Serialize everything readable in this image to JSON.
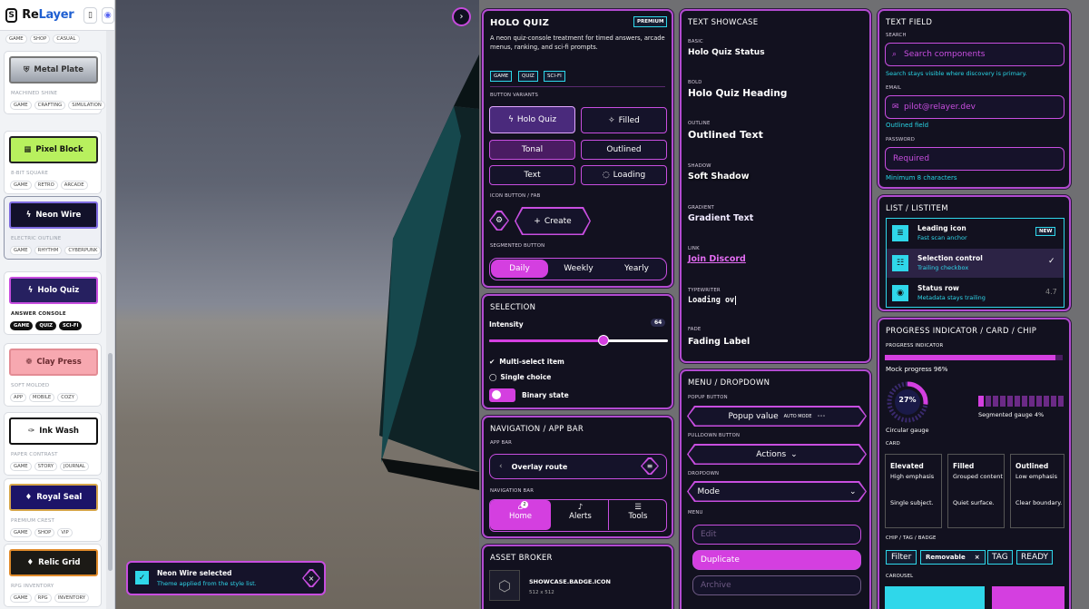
{
  "app": {
    "brand_a": "Re",
    "brand_b": "Layer",
    "book_icon": "book-icon",
    "discord_icon": "discord-icon"
  },
  "sidebar": {
    "top_tags": [
      "GAME",
      "SHOP",
      "CASUAL"
    ],
    "items": [
      {
        "label": "Metal Plate",
        "caption": "MACHINED SHINE",
        "tags": [
          "GAME",
          "CRAFTING",
          "SIMULATION"
        ]
      },
      {
        "label": "Pixel Block",
        "caption": "8-BIT SQUARE",
        "tags": [
          "GAME",
          "RETRO",
          "ARCADE"
        ]
      },
      {
        "label": "Neon Wire",
        "caption": "ELECTRIC OUTLINE",
        "tags": [
          "GAME",
          "RHYTHM",
          "CYBERPUNK"
        ]
      },
      {
        "label": "Holo Quiz",
        "caption": "ANSWER CONSOLE",
        "tags": [
          "GAME",
          "QUIZ",
          "SCI-FI"
        ]
      },
      {
        "label": "Clay Press",
        "caption": "SOFT MOLDED",
        "tags": [
          "APP",
          "MOBILE",
          "COZY"
        ]
      },
      {
        "label": "Ink Wash",
        "caption": "PAPER CONTRAST",
        "tags": [
          "GAME",
          "STORY",
          "JOURNAL"
        ]
      },
      {
        "label": "Royal Seal",
        "caption": "PREMIUM CREST",
        "tags": [
          "GAME",
          "SHOP",
          "VIP"
        ]
      },
      {
        "label": "Relic Grid",
        "caption": "RPG INVENTORY",
        "tags": [
          "GAME",
          "RPG",
          "INVENTORY"
        ]
      }
    ]
  },
  "toast": {
    "title": "Neon Wire selected",
    "message": "Theme applied from the style list."
  },
  "holo": {
    "title": "HOLO QUIZ",
    "badge": "PREMIUM",
    "desc": "A neon quiz-console treatment for timed answers, arcade menus, ranking, and sci-fi prompts.",
    "tags": [
      "GAME",
      "QUIZ",
      "SCI-FI"
    ],
    "variants_label": "BUTTON VARIANTS",
    "b_holo": "Holo Quiz",
    "b_filled": "Filled",
    "b_tonal": "Tonal",
    "b_outlined": "Outlined",
    "b_text": "Text",
    "b_loading": "Loading",
    "icon_label": "ICON BUTTON / FAB",
    "b_create": "Create",
    "seg_label": "SEGMENTED BUTTON",
    "seg": [
      "Daily",
      "Weekly",
      "Yearly"
    ]
  },
  "selection": {
    "title": "SELECTION",
    "intensity_label": "Intensity",
    "intensity": 64,
    "multi": "Multi-select item",
    "single": "Single choice",
    "binary": "Binary state"
  },
  "nav": {
    "title": "NAVIGATION / APP BAR",
    "appbar_label": "APP BAR",
    "route": "Overlay route",
    "navbar_label": "NAVIGATION BAR",
    "tabs": [
      "Home",
      "Alerts",
      "Tools"
    ],
    "home_badge": "2"
  },
  "asset": {
    "title": "ASSET BROKER",
    "name": "SHOWCASE.BADGE.ICON",
    "size": "512 x 512"
  },
  "text": {
    "title": "TEXT SHOWCASE",
    "rows": [
      {
        "label": "BASIC",
        "value": "Holo Quiz Status"
      },
      {
        "label": "BOLD",
        "value": "Holo Quiz Heading"
      },
      {
        "label": "OUTLINE",
        "value": "Outlined Text"
      },
      {
        "label": "SHADOW",
        "value": "Soft Shadow"
      },
      {
        "label": "GRADIENT",
        "value": "Gradient Text"
      },
      {
        "label": "LINK",
        "value": "Join Discord"
      },
      {
        "label": "TYPEWRITER",
        "value": "Loading ov"
      },
      {
        "label": "FADE",
        "value": "Fading Label"
      }
    ]
  },
  "menu": {
    "title": "MENU / DROPDOWN",
    "popup_label": "POPUP BUTTON",
    "popup_value": "Popup value",
    "auto": "AUTO MODE",
    "pull_label": "PULLDOWN BUTTON",
    "actions": "Actions",
    "drop_label": "DROPDOWN",
    "mode": "Mode",
    "menu_label": "MENU",
    "items": [
      "Edit",
      "Duplicate",
      "Archive"
    ]
  },
  "field": {
    "title": "TEXT FIELD",
    "search_label": "SEARCH",
    "search_ph": "Search components",
    "search_hint": "Search stays visible where discovery is primary.",
    "email_label": "EMAIL",
    "email": "pilot@relayer.dev",
    "email_hint": "Outlined field",
    "pw_label": "PASSWORD",
    "pw": "Required",
    "pw_hint": "Minimum 8 characters"
  },
  "list": {
    "title": "LIST / LISTITEM",
    "items": [
      {
        "title": "Leading icon",
        "sub": "Fast scan anchor",
        "trail": "NEW"
      },
      {
        "title": "Selection control",
        "sub": "Trailing checkbox",
        "trail": "✓"
      },
      {
        "title": "Status row",
        "sub": "Metadata stays trailing",
        "trail": "4.7"
      }
    ]
  },
  "progress": {
    "title": "PROGRESS INDICATOR / CARD / CHIP",
    "pi_label": "PROGRESS INDICATOR",
    "mock": "Mock progress 96%",
    "mock_value": 0.96,
    "circ": "27%",
    "circ_value": 0.27,
    "circ_label": "Circular gauge",
    "seg_label": "Segmented gauge 4%",
    "card_label": "CARD",
    "cards": [
      {
        "t": "Elevated",
        "a": "High emphasis",
        "b": "Single subject."
      },
      {
        "t": "Filled",
        "a": "Grouped content",
        "b": "Quiet surface."
      },
      {
        "t": "Outlined",
        "a": "Low emphasis",
        "b": "Clear boundary."
      }
    ],
    "chip_label": "CHIP / TAG / BADGE",
    "chips": [
      "Filter",
      "Removable",
      "TAG",
      "READY"
    ],
    "carousel_label": "CAROUSEL"
  },
  "colors": {
    "accent": "#c84ee0",
    "cyan": "#2fd7ea",
    "panel": "#12111f"
  }
}
